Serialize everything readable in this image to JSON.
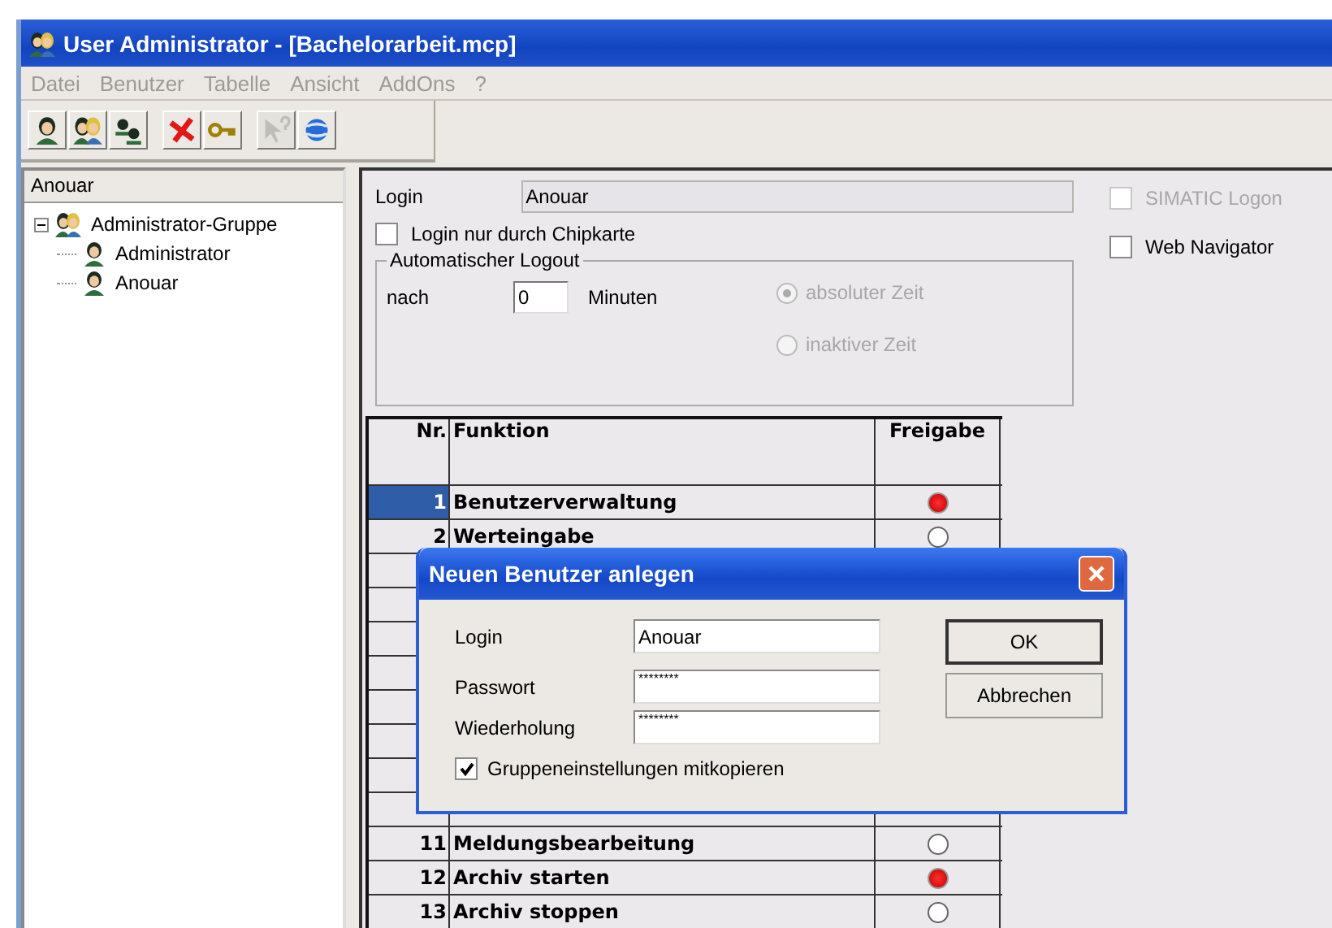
{
  "window": {
    "title": "User Administrator - [Bachelorarbeit.mcp]"
  },
  "menu": [
    {
      "label": "Datei"
    },
    {
      "label": "Benutzer"
    },
    {
      "label": "Tabelle"
    },
    {
      "label": "Ansicht"
    },
    {
      "label": "AddOns"
    },
    {
      "label": "?"
    }
  ],
  "toolbar": [
    [
      {
        "kind": "user",
        "disabled": false
      },
      {
        "kind": "users",
        "disabled": false
      },
      {
        "kind": "smallusers",
        "disabled": false
      }
    ],
    [
      {
        "kind": "delete",
        "disabled": false
      },
      {
        "kind": "key",
        "disabled": false
      }
    ],
    [
      {
        "kind": "help",
        "disabled": true
      },
      {
        "kind": "globe",
        "disabled": false
      }
    ]
  ],
  "tree": {
    "header": "Anouar",
    "items": [
      {
        "label": "Administrator-Gruppe",
        "expanded": true,
        "children": [
          {
            "label": "Administrator"
          },
          {
            "label": "Anouar"
          }
        ]
      }
    ]
  },
  "details": {
    "login_label": "Login",
    "login_value": "Anouar",
    "chipcard": {
      "label": "Login nur durch Chipkarte",
      "checked": false
    },
    "simatic": {
      "label": "SIMATIC Logon",
      "checked": false,
      "disabled": true
    },
    "web": {
      "label": "Web Navigator",
      "checked": false
    },
    "logout": {
      "title": "Automatischer Logout",
      "prefix": "nach",
      "value": "0",
      "unit": "Minuten",
      "options": [
        {
          "label": "absoluter Zeit",
          "selected": true,
          "disabled": true
        },
        {
          "label": "inaktiver Zeit",
          "selected": false,
          "disabled": true
        }
      ]
    }
  },
  "table": {
    "columns": [
      "Nr.",
      "Funktion",
      "Freigabe"
    ],
    "rows_above_dialog": [
      {
        "nr": "1",
        "funktion": "Benutzerverwaltung",
        "on": true,
        "selected": true
      },
      {
        "nr": "2",
        "funktion": "Werteingabe",
        "on": false,
        "selected": false
      }
    ],
    "rows_below_dialog": [
      {
        "nr": "11",
        "funktion": "Meldungsbearbeitung",
        "on": false,
        "selected": false
      },
      {
        "nr": "12",
        "funktion": "Archiv starten",
        "on": true,
        "selected": false
      },
      {
        "nr": "13",
        "funktion": "Archiv stoppen",
        "on": false,
        "selected": false
      }
    ]
  },
  "dialog": {
    "title": "Neuen Benutzer anlegen",
    "fields": [
      {
        "label": "Login",
        "value": "Anouar"
      },
      {
        "label": "Passwort",
        "value": "********"
      },
      {
        "label": "Wiederholung",
        "value": "********"
      }
    ],
    "copy": {
      "label": "Gruppeneinstellungen mitkopieren",
      "checked": true
    },
    "buttons": [
      {
        "label": "OK",
        "default": true
      },
      {
        "label": "Abbrechen",
        "default": false
      }
    ]
  }
}
